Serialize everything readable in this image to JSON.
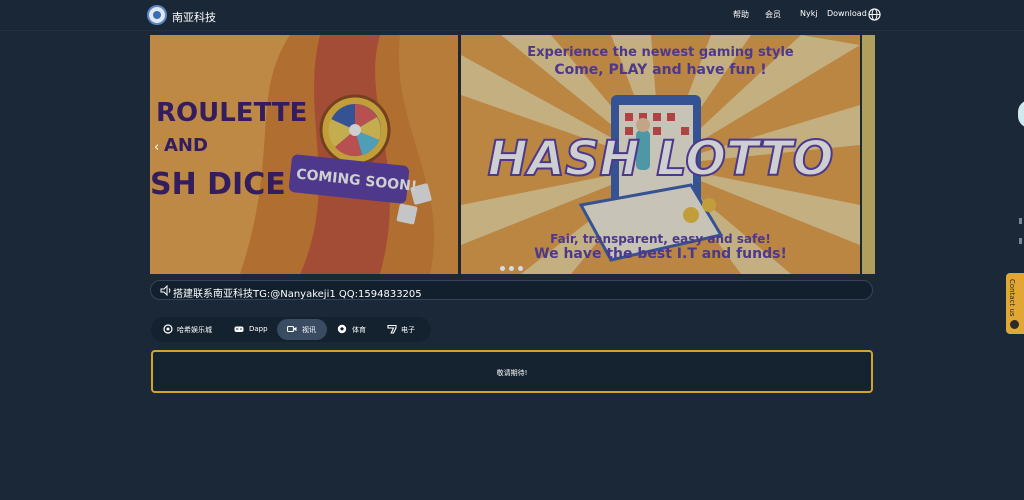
{
  "header": {
    "brand": "南亚科技",
    "nav": [
      "帮助",
      "会员",
      "Nykj",
      "Download"
    ]
  },
  "banner": {
    "left": {
      "line1": "ROULETTE",
      "line2": "AND",
      "line3": "SH DICE",
      "badge": "COMING SOON!"
    },
    "center": {
      "top1": "Experience the newest gaming style",
      "top2": "Come, PLAY and have fun !",
      "title": "HASH LOTTO",
      "bottom1": "Fair, transparent, easy and safe!",
      "bottom2": "We have the best I.T and funds!"
    },
    "active_slide": 1,
    "slide_count": 3
  },
  "notice": {
    "text": "搭建联系南亚科技TG:@Nanyakeji1 QQ:1594833205"
  },
  "tabs": [
    {
      "label": "哈希娱乐城",
      "icon": "chip-icon",
      "active": false
    },
    {
      "label": "Dapp",
      "icon": "gamepad-icon",
      "active": false
    },
    {
      "label": "视讯",
      "icon": "video-camera-icon",
      "active": true
    },
    {
      "label": "体育",
      "icon": "soccer-ball-icon",
      "active": false
    },
    {
      "label": "电子",
      "icon": "slot-machine-icon",
      "active": false
    }
  ],
  "panel": {
    "text": "敬请期待!"
  },
  "contact": {
    "label": "Contact us"
  },
  "colors": {
    "background": "#1b2838",
    "accent": "#d4a429",
    "active_tab": "#3a4c62"
  }
}
